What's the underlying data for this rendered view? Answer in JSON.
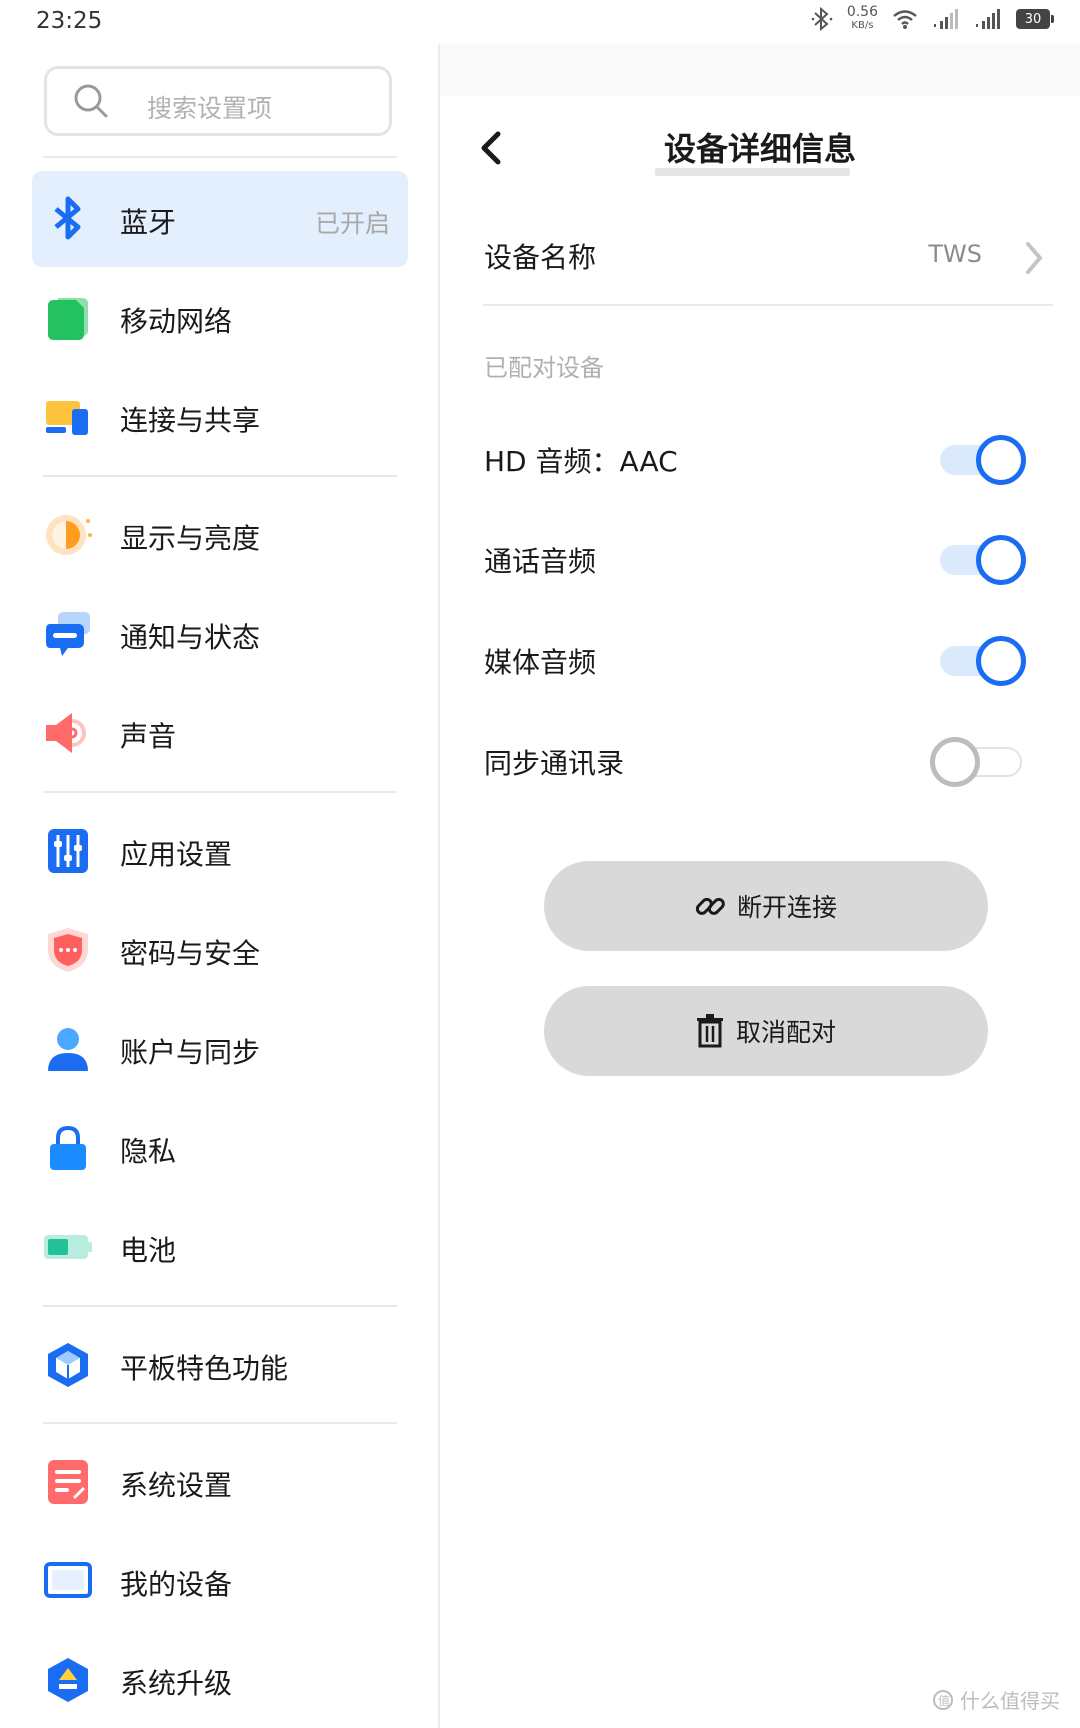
{
  "status_bar": {
    "time": "23:25",
    "net_speed_value": "0.56",
    "net_speed_unit": "KB/s",
    "battery": "30",
    "icons": [
      "bluetooth-icon",
      "wifi-icon",
      "signal-icon",
      "signal-icon",
      "battery-icon"
    ]
  },
  "sidebar": {
    "search_placeholder": "搜索设置项",
    "items": [
      {
        "label": "蓝牙",
        "status": "已开启",
        "icon": "bluetooth-icon",
        "active": true
      },
      {
        "label": "移动网络",
        "icon": "mobile-network-icon"
      },
      {
        "label": "连接与共享",
        "icon": "connection-sharing-icon"
      },
      {
        "label": "显示与亮度",
        "icon": "display-brightness-icon"
      },
      {
        "label": "通知与状态",
        "icon": "notification-icon"
      },
      {
        "label": "声音",
        "icon": "sound-icon"
      },
      {
        "label": "应用设置",
        "icon": "app-settings-icon"
      },
      {
        "label": "密码与安全",
        "icon": "password-security-icon"
      },
      {
        "label": "账户与同步",
        "icon": "account-icon"
      },
      {
        "label": "隐私",
        "icon": "privacy-lock-icon"
      },
      {
        "label": "电池",
        "icon": "battery-icon"
      },
      {
        "label": "平板特色功能",
        "icon": "tablet-features-icon"
      },
      {
        "label": "系统设置",
        "icon": "system-settings-icon"
      },
      {
        "label": "我的设备",
        "icon": "my-device-icon"
      },
      {
        "label": "系统升级",
        "icon": "system-update-icon"
      }
    ]
  },
  "detail": {
    "title": "设备详细信息",
    "device_name_label": "设备名称",
    "device_name_value": "TWS",
    "paired_section": "已配对设备",
    "toggles": [
      {
        "label": "HD 音频：AAC",
        "on": true
      },
      {
        "label": "通话音频",
        "on": true
      },
      {
        "label": "媒体音频",
        "on": true
      },
      {
        "label": "同步通讯录",
        "on": false
      }
    ],
    "disconnect_label": "断开连接",
    "unpair_label": "取消配对"
  },
  "watermark": "什么值得买",
  "colors": {
    "accent": "#1a6cf2",
    "active_bg": "#e3effd",
    "button_bg": "#d9d9d9"
  }
}
